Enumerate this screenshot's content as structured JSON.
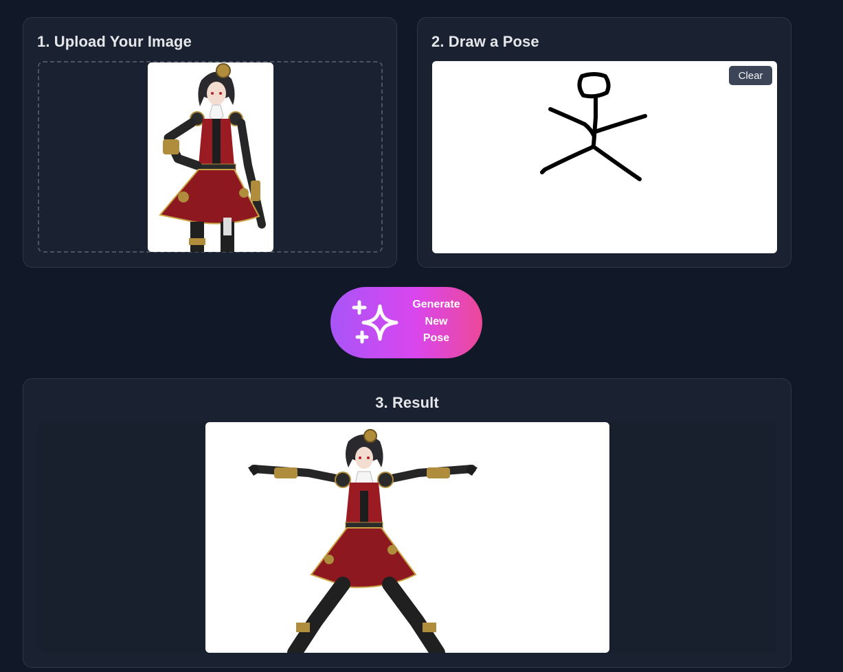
{
  "upload": {
    "title": "1. Upload Your Image"
  },
  "pose": {
    "title": "2. Draw a Pose",
    "clear_label": "Clear"
  },
  "generate": {
    "label_lines": [
      "Generate",
      "New",
      "Pose"
    ],
    "icon": "sparkle-icon"
  },
  "result": {
    "title": "3. Result"
  },
  "colors": {
    "background": "#111827",
    "panel": "#1a2130",
    "gradient_start": "#a855f7",
    "gradient_end": "#ec4899"
  }
}
